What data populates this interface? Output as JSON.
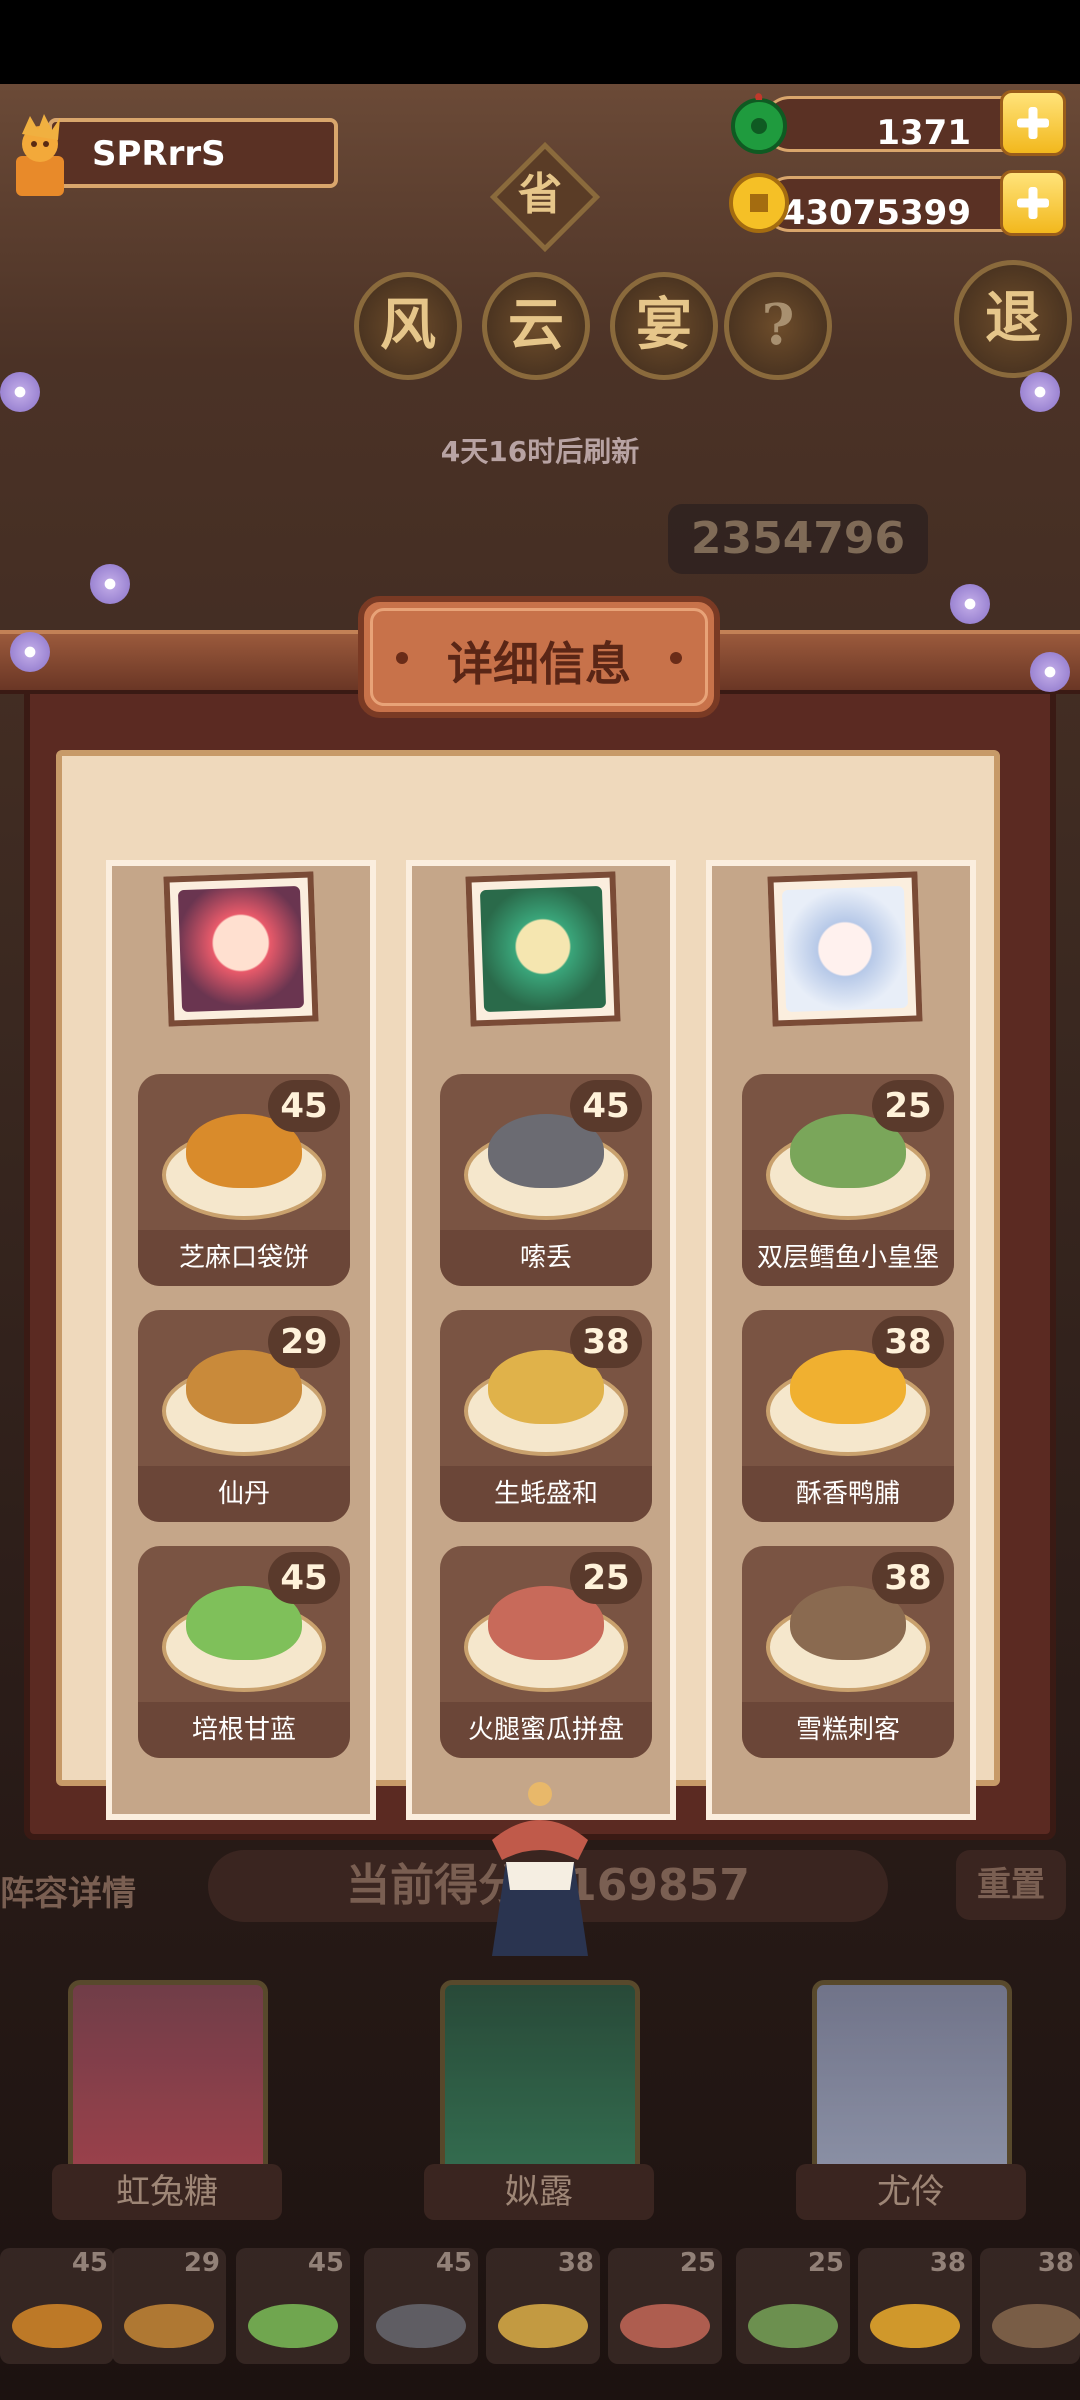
{
  "player": {
    "name": "SPRrrS"
  },
  "currency": {
    "jade": "1371",
    "coins": "43075399"
  },
  "event": {
    "title_chars": [
      "风",
      "云",
      "宴"
    ],
    "help": "?",
    "province": "省",
    "exit": "退",
    "refresh": "4天16时后刷新",
    "top_score": "2354796"
  },
  "panel": {
    "title": "详细信息",
    "columns": [
      {
        "portrait_color": "#e85a6a",
        "dishes": [
          {
            "name": "芝麻口袋饼",
            "score": "45",
            "food_color": "#d98b2b"
          },
          {
            "name": "仙丹",
            "score": "29",
            "food_color": "#c98a3a"
          },
          {
            "name": "培根甘蓝",
            "score": "45",
            "food_color": "#7fc05a"
          }
        ]
      },
      {
        "portrait_color": "#3aa57a",
        "dishes": [
          {
            "name": "嗦丢",
            "score": "45",
            "food_color": "#6b6b72"
          },
          {
            "name": "生蚝盛和",
            "score": "38",
            "food_color": "#e0b24a"
          },
          {
            "name": "火腿蜜瓜拼盘",
            "score": "25",
            "food_color": "#c86a5a"
          }
        ]
      },
      {
        "portrait_color": "#b7c9e8",
        "dishes": [
          {
            "name": "双层鳕鱼小皇堡",
            "score": "25",
            "food_color": "#7aa65a"
          },
          {
            "name": "酥香鸭脯",
            "score": "38",
            "food_color": "#f0b030"
          },
          {
            "name": "雪糕刺客",
            "score": "38",
            "food_color": "#8a6a50"
          }
        ]
      }
    ]
  },
  "bottom": {
    "left_tab": "阵容详情",
    "current_score": "当前得分：169857",
    "reset": "重置",
    "characters": [
      {
        "name": "虹兔糖",
        "color": "#c4505e"
      },
      {
        "name": "姒露",
        "color": "#3a8a64"
      },
      {
        "name": "尤伶",
        "color": "#aeb9d6"
      }
    ],
    "strip": [
      {
        "score": "45",
        "color": "#d98b2b"
      },
      {
        "score": "29",
        "color": "#c98a3a"
      },
      {
        "score": "45",
        "color": "#7fc05a"
      },
      {
        "score": "45",
        "color": "#6b6b72"
      },
      {
        "score": "38",
        "color": "#e0b24a"
      },
      {
        "score": "25",
        "color": "#c86a5a"
      },
      {
        "score": "25",
        "color": "#7aa65a"
      },
      {
        "score": "38",
        "color": "#f0b030"
      },
      {
        "score": "38",
        "color": "#8a6a50"
      }
    ]
  }
}
